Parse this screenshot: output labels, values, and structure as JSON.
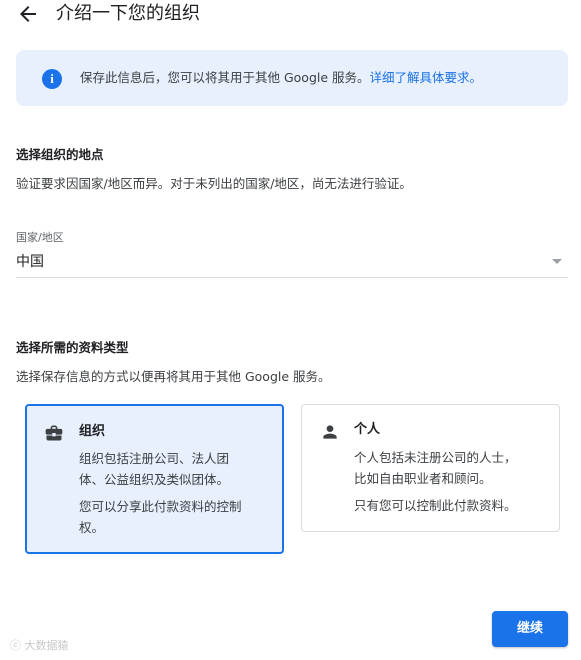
{
  "header": {
    "title": "介绍一下您的组织"
  },
  "banner": {
    "text": "保存此信息后，您可以将其用于其他 Google 服务。",
    "link": "详细了解具体要求。"
  },
  "location": {
    "title": "选择组织的地点",
    "desc": "验证要求因国家/地区而异。对于未列出的国家/地区，尚无法进行验证。",
    "field_label": "国家/地区",
    "value": "中国"
  },
  "profile_type": {
    "title": "选择所需的资料类型",
    "desc": "选择保存信息的方式以便再将其用于其他 Google 服务。",
    "organization": {
      "title": "组织",
      "desc_line1": "组织包括注册公司、法人团",
      "desc_line2": "体、公益组织及类似团体。",
      "note_line1": "您可以分享此付款资料的控制",
      "note_line2": "权。"
    },
    "individual": {
      "title": "个人",
      "desc_line1": "个人包括未注册公司的人士，",
      "desc_line2": "比如自由职业者和顾问。",
      "note": "只有您可以控制此付款资料。"
    }
  },
  "actions": {
    "continue": "继续"
  },
  "watermark": "大数据猿",
  "colors": {
    "accent": "#1a73e8",
    "banner_bg": "#e8f0fe"
  }
}
